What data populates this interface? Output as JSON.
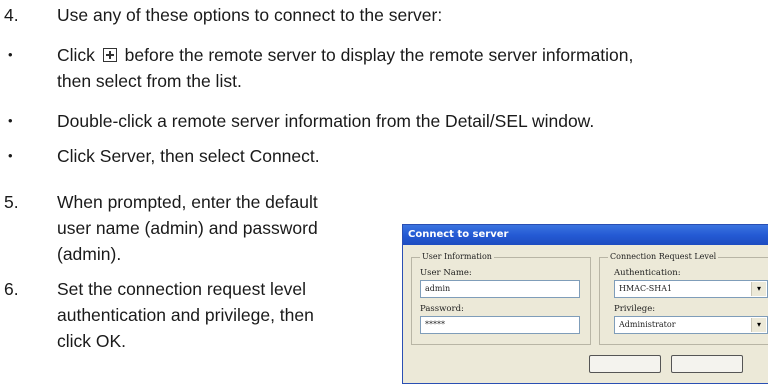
{
  "steps": [
    {
      "number": "4.",
      "text": "Use any of these options to connect to the server:"
    },
    {
      "number": "5.",
      "lines": [
        "When prompted, enter the default",
        "user name (admin) and password",
        "(admin)."
      ]
    },
    {
      "number": "6.",
      "lines": [
        "Set the connection request level",
        "authentication and privilege, then",
        "click OK."
      ]
    }
  ],
  "bullets": [
    {
      "text_before": "Click",
      "icon": "expand-plus-icon",
      "text_after": "before the remote server to display the remote server information,",
      "line2": "then select from the list."
    },
    {
      "text": "Double-click a remote server information from the Detail/SEL window."
    },
    {
      "text": "Click Server, then select Connect."
    }
  ],
  "dialog": {
    "title": "Connect to server",
    "user_group": {
      "title": "User Information",
      "user_name_label": "User Name:",
      "user_name_value": "admin",
      "password_label": "Password:",
      "password_value": "*****"
    },
    "request_group": {
      "title": "Connection Request Level",
      "authentication_label": "Authentication:",
      "authentication_value": "HMAC-SHA1",
      "privilege_label": "Privilege:",
      "privilege_value": "Administrator"
    }
  }
}
